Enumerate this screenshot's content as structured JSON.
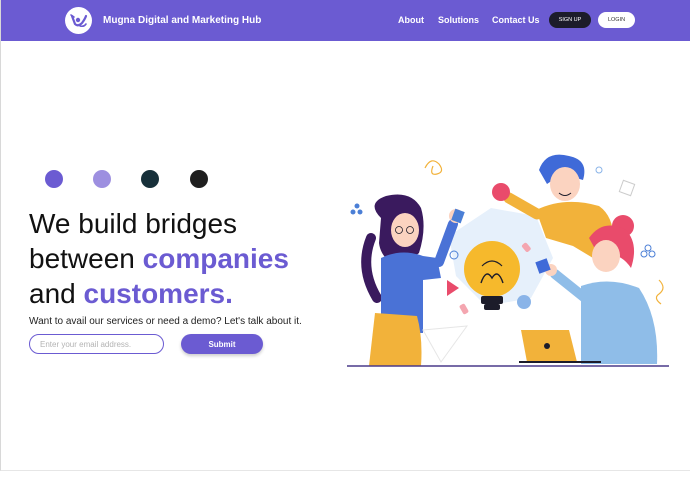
{
  "brand": {
    "name": "Mugna Digital and Marketing Hub",
    "logo_icon": "bird-logo-icon"
  },
  "nav": {
    "links": [
      "About",
      "Solutions",
      "Contact Us"
    ],
    "signup_label": "SIGN UP",
    "login_label": "LOGIN"
  },
  "colors": {
    "accent": "#6b5bd2",
    "dark": "#1c1c2a",
    "swatches": [
      "#6b5bd2",
      "#9d8fe0",
      "#17303a",
      "#1f1f1f"
    ]
  },
  "hero": {
    "line1": "We build bridges",
    "line2_prefix": "between ",
    "line2_accent": "companies",
    "line3_prefix": "and ",
    "line3_accent": "customers.",
    "subtext": "Want to avail our services or need a demo? Let's talk about it.",
    "email_placeholder": "Enter your email address.",
    "submit_label": "Submit"
  },
  "illustration": {
    "description_icon": "team-brainstorm-illustration"
  }
}
